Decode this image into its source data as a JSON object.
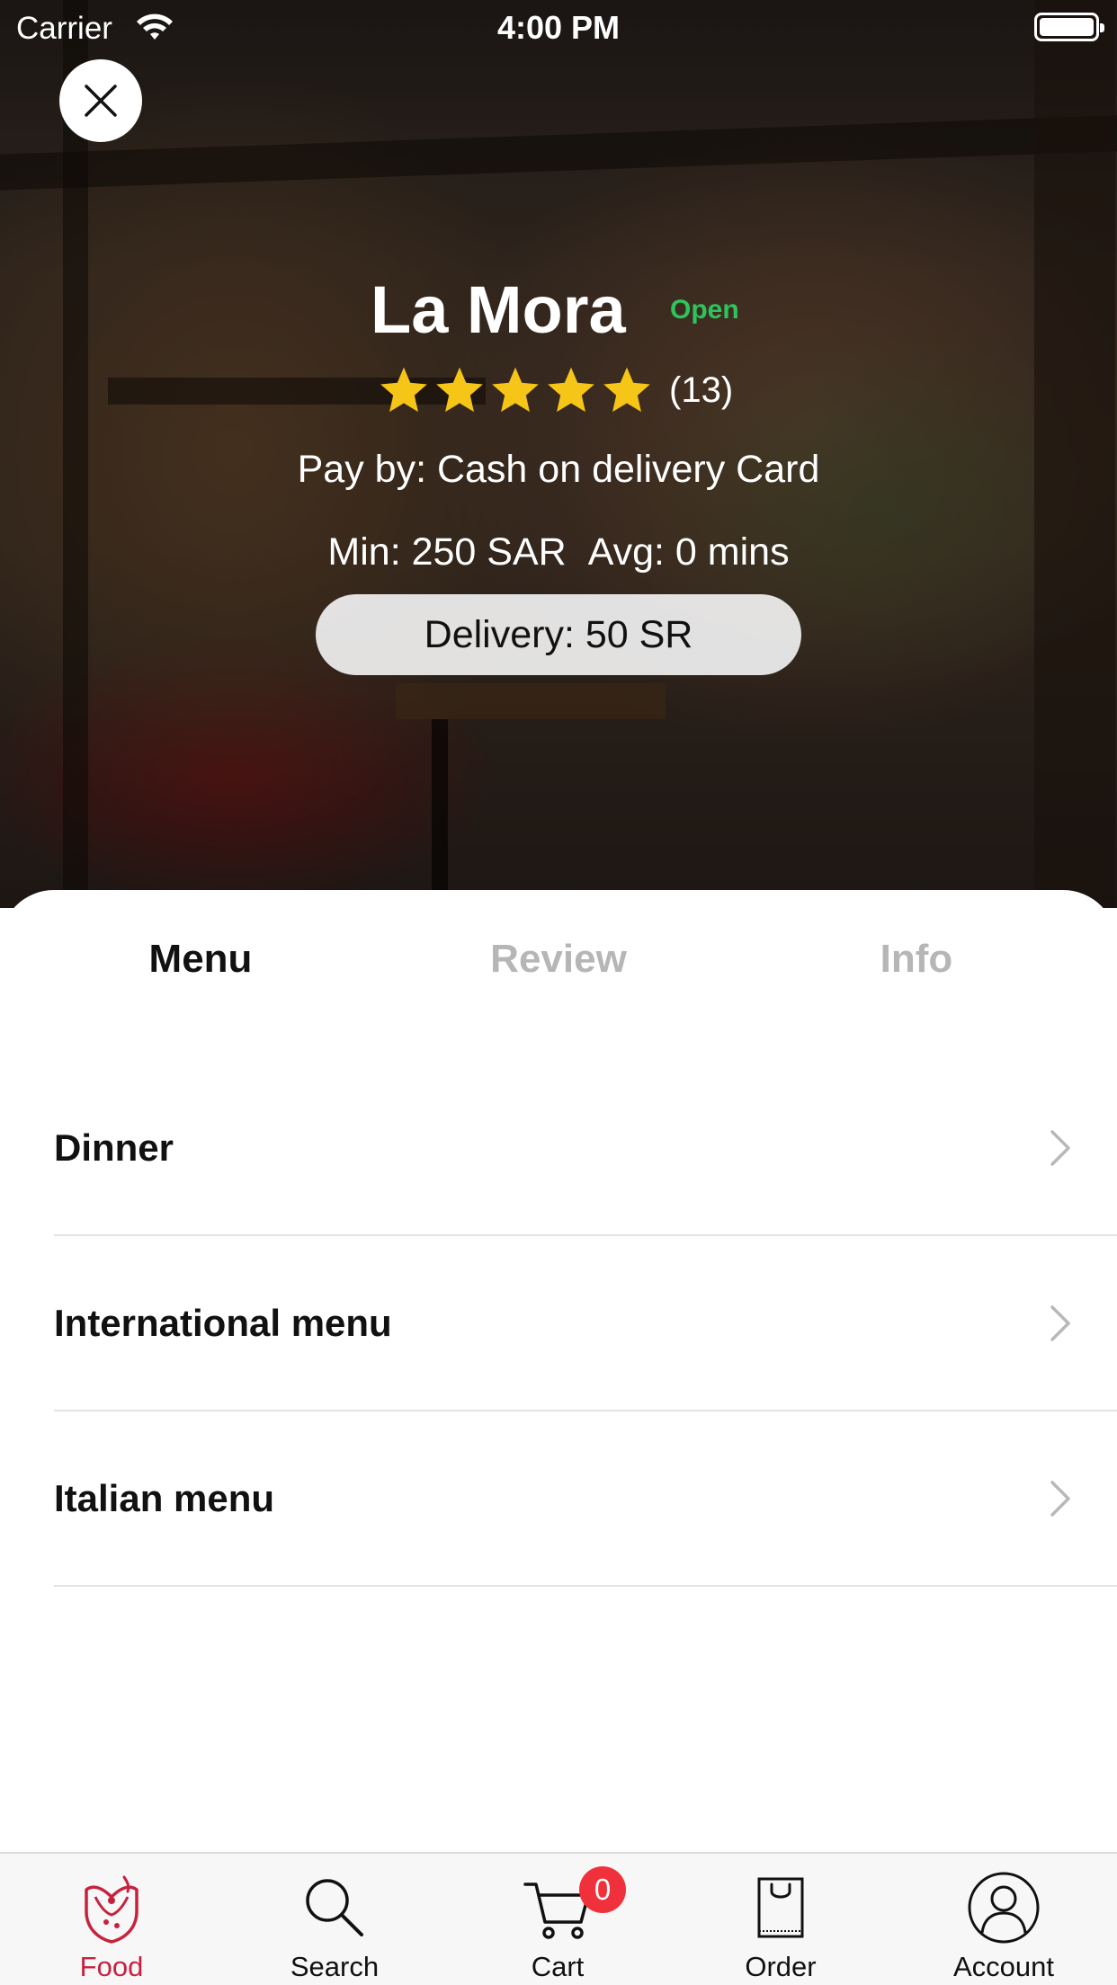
{
  "status_bar": {
    "carrier": "Carrier",
    "time": "4:00 PM"
  },
  "restaurant": {
    "name": "La Mora",
    "status": "Open",
    "rating": 5,
    "max_rating": 5,
    "rating_count": "(13)",
    "pay_by": "Pay by: Cash on delivery Card",
    "min_order": "Min: 250 SAR",
    "avg_time": "Avg: 0 mins",
    "delivery": "Delivery: 50 SR"
  },
  "tabs": [
    {
      "label": "Menu",
      "active": true
    },
    {
      "label": "Review",
      "active": false
    },
    {
      "label": "Info",
      "active": false
    }
  ],
  "menu_items": [
    {
      "label": "Dinner"
    },
    {
      "label": "International menu"
    },
    {
      "label": "Italian menu"
    }
  ],
  "tab_bar": {
    "items": [
      {
        "label": "Food",
        "icon": "food-icon",
        "active": true
      },
      {
        "label": "Search",
        "icon": "search-icon",
        "active": false
      },
      {
        "label": "Cart",
        "icon": "cart-icon",
        "active": false
      },
      {
        "label": "Order",
        "icon": "order-bag-icon",
        "active": false
      },
      {
        "label": "Account",
        "icon": "account-icon",
        "active": false
      }
    ],
    "cart_count": "0"
  },
  "colors": {
    "open_green": "#2ec45c",
    "star_yellow": "#f5c518",
    "accent_red": "#c7223d",
    "badge_red": "#f0303a"
  }
}
